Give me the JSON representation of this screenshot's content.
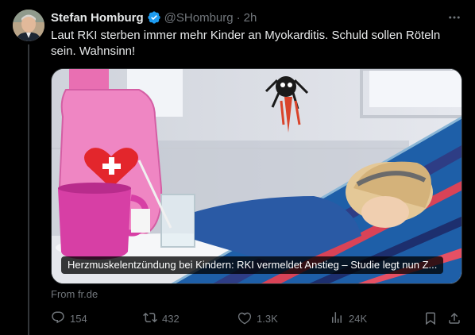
{
  "author": {
    "name": "Stefan Homburg",
    "handle": "@SHomburg",
    "separator": "·",
    "time": "2h"
  },
  "tweet": {
    "text": "Laut RKI sterben immer mehr Kinder an Myokarditis. Schuld sollen Röteln sein. Wahnsinn!"
  },
  "card": {
    "caption": "Herzmuskelentzündung bei Kindern: RKI vermeldet Anstieg – Studie legt nun Z...",
    "source": "From fr.de"
  },
  "actions": {
    "replies": "154",
    "reposts": "432",
    "likes": "1.3K",
    "views": "24K"
  },
  "colors": {
    "background": "#000000",
    "text_primary": "#e7e9ea",
    "text_secondary": "#71767b",
    "verified_blue": "#1d9bf0"
  },
  "icons": {
    "verified": "verified-badge-icon",
    "more": "more-dots-icon",
    "reply": "reply-icon",
    "repost": "repost-icon",
    "like": "heart-icon",
    "views": "views-icon",
    "bookmark": "bookmark-icon",
    "share": "share-icon"
  }
}
